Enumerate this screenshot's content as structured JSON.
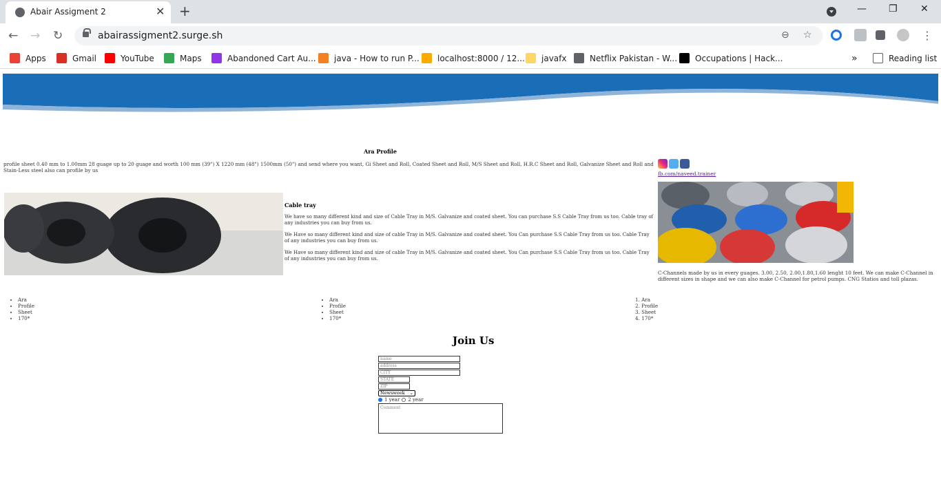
{
  "browser": {
    "tab_title": "Abair Assigment 2",
    "url": "abairassigment2.surge.sh",
    "bookmarks": [
      {
        "label": "Apps",
        "color": "#ea4335"
      },
      {
        "label": "Gmail",
        "color": "#d93025"
      },
      {
        "label": "YouTube",
        "color": "#ff0000"
      },
      {
        "label": "Maps",
        "color": "#34a853"
      },
      {
        "label": "Abandoned Cart Au...",
        "color": "#9334e6"
      },
      {
        "label": "java - How to run P...",
        "color": "#f48024"
      },
      {
        "label": "localhost:8000 / 12...",
        "color": "#f9ab00"
      },
      {
        "label": "javafx",
        "color": "#fdd663"
      },
      {
        "label": "Netflix Pakistan - W...",
        "color": "#5f6368"
      },
      {
        "label": "Occupations | Hack...",
        "color": "#000000"
      }
    ],
    "more_label": "»",
    "reading_list": "Reading list"
  },
  "page": {
    "section_title": "Ara Profile",
    "intro": "profile sheet 0.40 mm to 1.00mm 28 guage up to 20 guage and worth 100 mm (39\") X 1220 mm (48\") 1500mm (50\") and send where you want, Gi Sheet and Roll, Coated Sheet and Roll, M/S Sheet and Roll, H.R.C Sheet and Roll, Galvanize Sheet and Roll and Stain-Less steel also can profile by us",
    "fb_link": "fb.com/naveed.trainer",
    "cable_title": "Cable tray",
    "cable_paras": [
      "We have so many different kind and size of Cable Tray in M/S. Galvanize and coated sheet. You can purchase S.S Cable Tray from us too. Cable tray of any industries you can buy from us.",
      "We Have so many different kind and size of cable Tray in M/S. Galvanize and coated sheet. You Can purchase S.S Cable Tray from us too. Cable Tray of any industries you can buy from us.",
      "We Have so many different kind and size of cable Tray in M/S. Galvanize and coated sheet. You Can purchase S.S Cable Tray from us too. Cable Tray of any industries you can buy from us."
    ],
    "channels": "C-Channels made by us in every guages. 3.00, 2.50, 2.00,1.80,1.60 lenght 10 feet. We can make C-Channel in different sizes in shape and we can also make C-Channel for petrol pumps. CNG Statios and toll plazas.",
    "list1": [
      "Ara",
      "Profile",
      "Sheet",
      "170*"
    ],
    "list2": [
      "Ara",
      "Profile",
      "Sheet",
      "170*"
    ],
    "list3": [
      "1. Ara",
      "2. Profile",
      "3. Sheet",
      "4. 170*"
    ],
    "join_title": "Join Us",
    "form": {
      "name_ph": "name",
      "address_ph": "address",
      "city_ph": "CITY",
      "state_ph": "STATE",
      "zip_ph": "ZIP",
      "select_value": "Newsweek",
      "radio1": "1 year",
      "radio2": "2 year",
      "comment_ph": "Comment"
    }
  }
}
